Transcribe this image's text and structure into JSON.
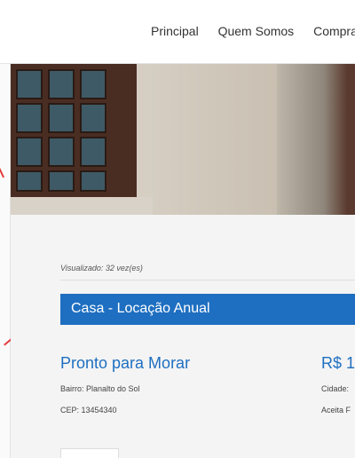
{
  "nav": {
    "items": [
      "Principal",
      "Quem Somos",
      "Compra"
    ]
  },
  "listing": {
    "viewed": "Visualizado: 32 vez(es)",
    "type": "Casa - Locação Anual",
    "title": "Pronto para Morar",
    "price": "R$ 1",
    "bairro": "Bairro: Planalto do Sol",
    "cep": "CEP: 13454340",
    "cidade": "Cidade:",
    "aceita": "Aceita F"
  },
  "colors": {
    "accent": "#1e6fc1"
  }
}
